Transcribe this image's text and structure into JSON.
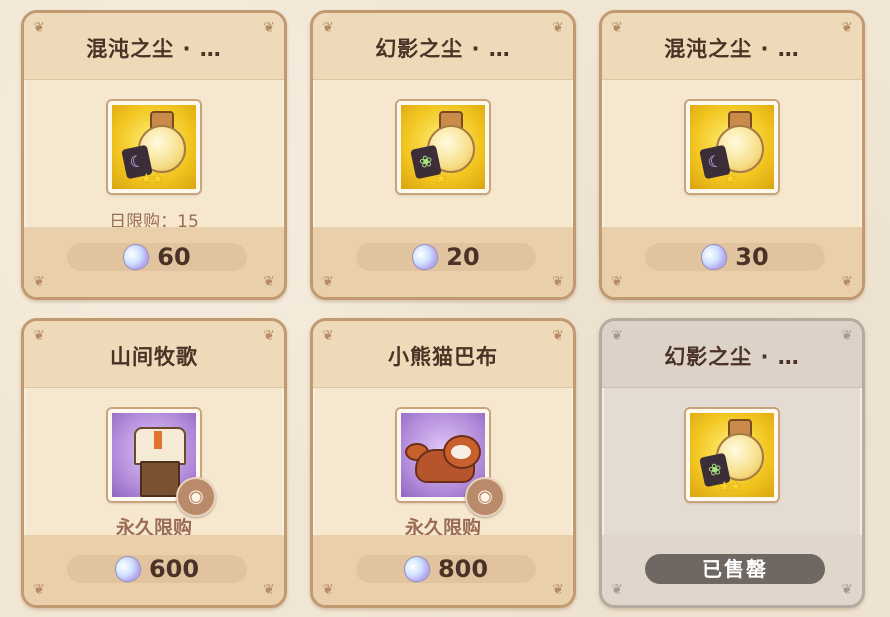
{
  "shop_items": [
    {
      "title": "混沌之尘 · …",
      "icon": "chaos-dust-flask-icon",
      "stars": "★★",
      "limit": "日限购：15",
      "price": "60",
      "currency_icon": "crystal-gem-icon",
      "sold_out": false
    },
    {
      "title": "幻影之尘 · …",
      "icon": "phantom-dust-flask-icon",
      "stars": "★",
      "limit": "",
      "price": "20",
      "currency_icon": "crystal-gem-icon",
      "sold_out": false
    },
    {
      "title": "混沌之尘 · …",
      "icon": "chaos-dust-flask-icon",
      "stars": "★",
      "limit": "",
      "price": "30",
      "currency_icon": "crystal-gem-icon",
      "sold_out": false
    },
    {
      "title": "山间牧歌",
      "icon": "outfit-icon",
      "stars": "",
      "limit": "永久限购",
      "price": "600",
      "currency_icon": "crystal-gem-icon",
      "sold_out": false,
      "preview_icon": "eye-icon"
    },
    {
      "title": "小熊猫巴布",
      "icon": "red-panda-icon",
      "stars": "",
      "limit": "永久限购",
      "price": "800",
      "currency_icon": "crystal-gem-icon",
      "sold_out": false,
      "preview_icon": "eye-icon"
    },
    {
      "title": "幻影之尘 · …",
      "icon": "phantom-dust-flask-icon",
      "stars": "★★",
      "limit": "",
      "status": "已售罄",
      "sold_out": true
    }
  ]
}
